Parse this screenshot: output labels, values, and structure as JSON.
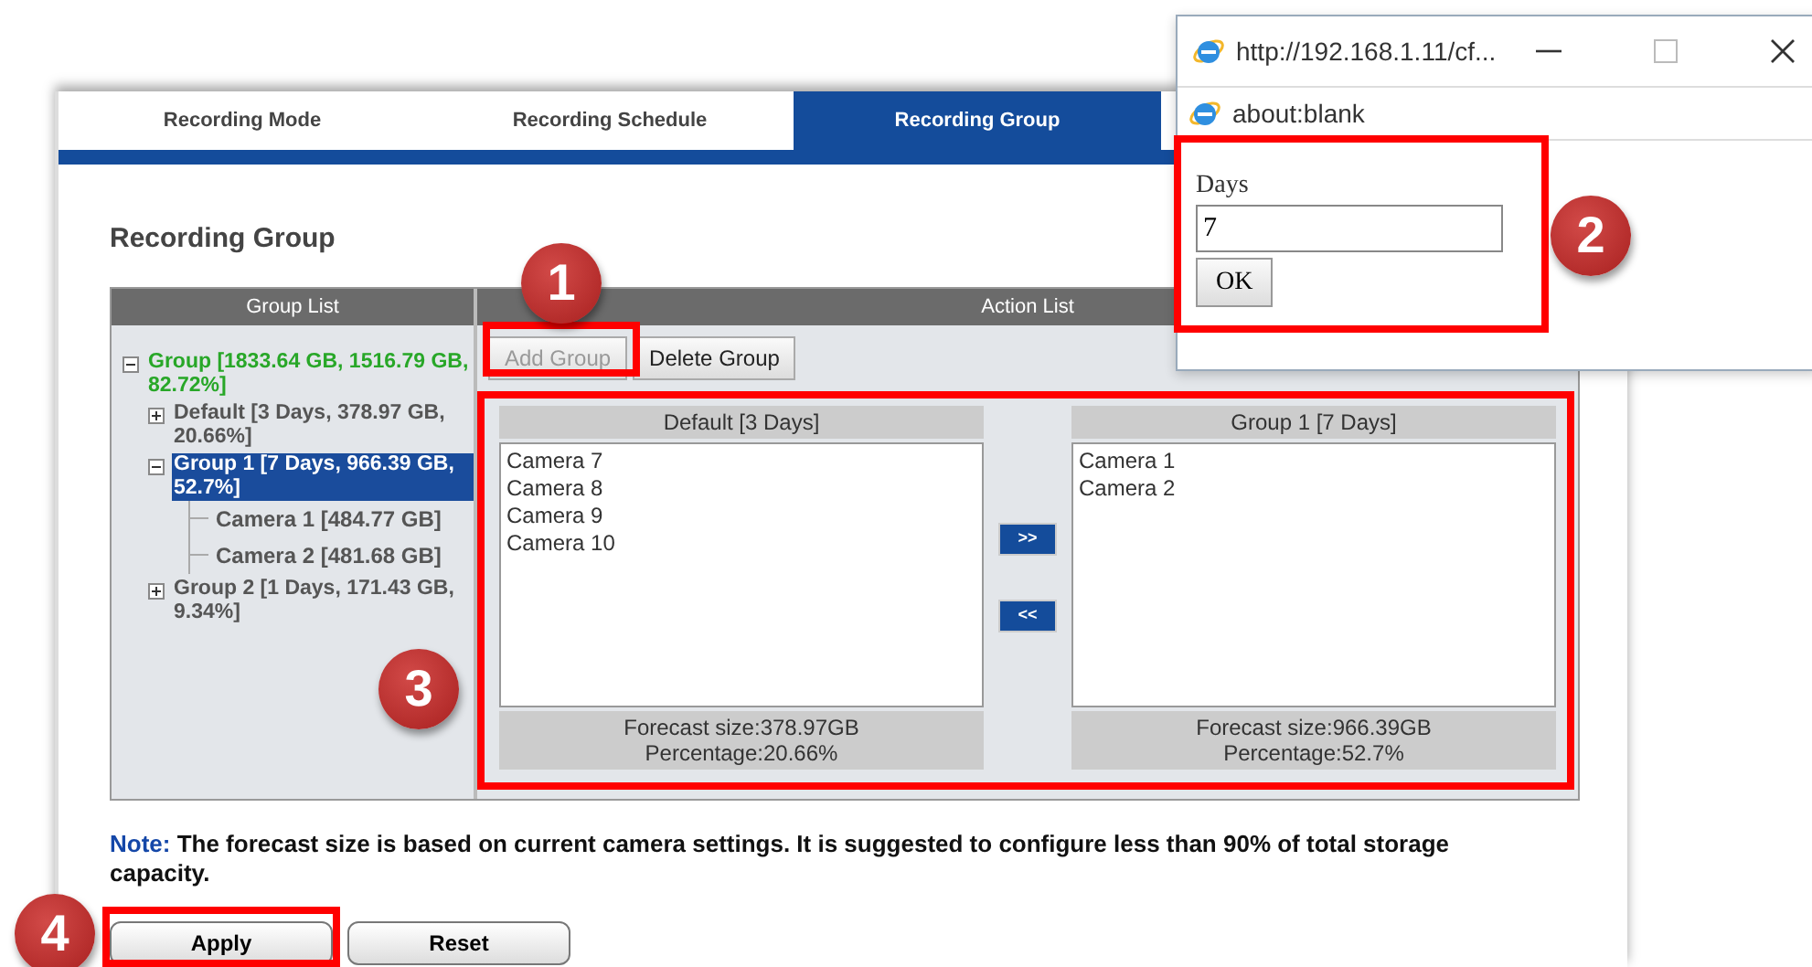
{
  "tabs": [
    {
      "label": "Recording Mode",
      "selected": false
    },
    {
      "label": "Recording Schedule",
      "selected": false
    },
    {
      "label": "Recording Group",
      "selected": true
    }
  ],
  "title": "Recording Group",
  "group_list": {
    "header": "Group List",
    "tree": [
      {
        "label": "Group [1833.64 GB, 1516.79 GB, 82.72%]",
        "expanded": true,
        "selected": false,
        "children": [
          {
            "label": "Default [3 Days, 378.97 GB, 20.66%]",
            "expanded": false,
            "selected": false
          },
          {
            "label": "Group 1 [7 Days, 966.39 GB, 52.7%]",
            "expanded": true,
            "selected": true,
            "children": [
              {
                "label": "Camera 1 [484.77 GB]",
                "selected": false
              },
              {
                "label": "Camera 2 [481.68 GB]",
                "selected": false
              }
            ]
          },
          {
            "label": "Group 2 [1 Days, 171.43 GB, 9.34%]",
            "expanded": false,
            "selected": false
          }
        ]
      }
    ]
  },
  "action_list": {
    "header": "Action List",
    "buttons": [
      {
        "label": "Add Group",
        "disabled": true
      },
      {
        "label": "Delete Group",
        "disabled": false
      }
    ],
    "left": {
      "title": "Default [3 Days]",
      "items": [
        "Camera 7",
        "Camera 8",
        "Camera 9",
        "Camera 10"
      ],
      "forecast": "Forecast size:378.97GB",
      "percentage": "Percentage:20.66%"
    },
    "move_buttons": [
      ">>",
      "<<"
    ],
    "right": {
      "title": "Group 1 [7 Days]",
      "items": [
        "Camera 1",
        "Camera 2"
      ],
      "forecast": "Forecast size:966.39GB",
      "percentage": "Percentage:52.7%"
    }
  },
  "note": {
    "label": "Note:",
    "text": "The forecast size is based on current camera settings. It is suggested to configure less than 90% of total storage capacity."
  },
  "buttons": [
    "Apply",
    "Reset"
  ],
  "popup": {
    "title": "http://192.168.1.11/cf...",
    "address": "about:blank",
    "field_label": "Days",
    "value": "7",
    "ok": "OK"
  },
  "callouts": [
    "1",
    "2",
    "3",
    "4"
  ]
}
